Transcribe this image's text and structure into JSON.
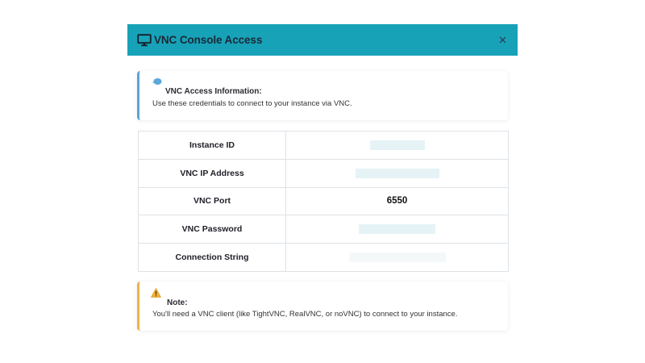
{
  "modal": {
    "title": "VNC Console Access",
    "title_icon": "monitor-icon",
    "close_icon": "close-icon",
    "header_color": "#17a2b8"
  },
  "info": {
    "icon": "speech-bubble-icon",
    "heading": "VNC Access Information:",
    "description": "Use these credentials to connect to your instance via VNC.",
    "accent_color": "#5ba5d6"
  },
  "credentials": {
    "rows": [
      {
        "label": "Instance ID",
        "value": "",
        "redacted": true
      },
      {
        "label": "VNC IP Address",
        "value": "",
        "redacted": true
      },
      {
        "label": "VNC Port",
        "value": "6550",
        "redacted": false
      },
      {
        "label": "VNC Password",
        "value": "",
        "redacted": true
      },
      {
        "label": "Connection String",
        "value": "",
        "redacted": true
      }
    ]
  },
  "note": {
    "icon": "warning-icon",
    "heading": "Note:",
    "description": "You'll need a VNC client (like TightVNC, RealVNC, or noVNC) to connect to your instance.",
    "accent_color": "#f0b24a"
  }
}
